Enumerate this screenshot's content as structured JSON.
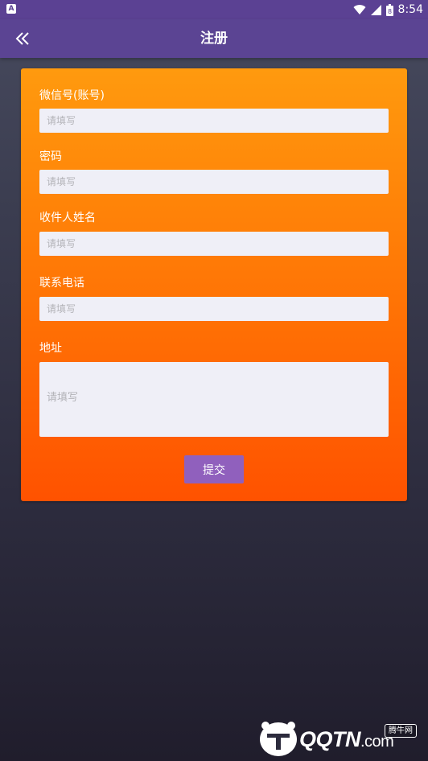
{
  "status_bar": {
    "time": "8:54",
    "notification_icon": "app-notification-icon",
    "battery_level": "8"
  },
  "app_bar": {
    "title": "注册",
    "back_icon": "double-chevron-left-icon"
  },
  "form": {
    "fields": [
      {
        "label": "微信号(账号)",
        "placeholder": "请填写",
        "value": ""
      },
      {
        "label": "密码",
        "placeholder": "请填写",
        "value": ""
      },
      {
        "label": "收件人姓名",
        "placeholder": "请填写",
        "value": ""
      },
      {
        "label": "联系电话",
        "placeholder": "请填写",
        "value": ""
      },
      {
        "label": "地址",
        "placeholder": "请填写",
        "value": ""
      }
    ],
    "submit_label": "提交"
  },
  "watermark": {
    "brand": "QQTN",
    "suffix": ".com",
    "badge": "腾牛网"
  },
  "colors": {
    "app_bar": "#5b4493",
    "card_top": "#ff9a0e",
    "card_bottom": "#ff5200",
    "input_bg": "#efeff7",
    "button": "#9060bd"
  }
}
